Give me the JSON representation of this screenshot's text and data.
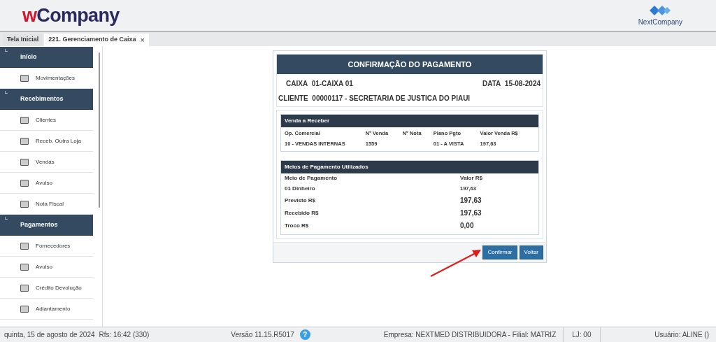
{
  "header": {
    "logo": {
      "prefix": "w",
      "name": "Company"
    },
    "brand": "NextCompany"
  },
  "tabs": [
    {
      "label": "Tela Inicial",
      "selected": false
    },
    {
      "label": "221. Gerenciamento de Caixa",
      "selected": true,
      "close": "×"
    }
  ],
  "sidebar": {
    "sections": [
      {
        "title": "Início",
        "items": [
          "Movimentações"
        ]
      },
      {
        "title": "Recebimentos",
        "items": [
          "Clientes",
          "Receb. Outra Loja",
          "Vendas",
          "Avulso",
          "Nota Fiscal"
        ]
      },
      {
        "title": "Pagamentos",
        "items": [
          "Fornecedores",
          "Avulso",
          "Crédito Devolução",
          "Adiantamento"
        ]
      }
    ]
  },
  "dialog": {
    "title": "CONFIRMAÇÃO DO PAGAMENTO",
    "caixa": {
      "label": "CAIXA",
      "value": "01-CAIXA 01"
    },
    "data": {
      "label": "DATA",
      "value": "15-08-2024"
    },
    "cliente": {
      "label": "CLIENTE",
      "value": "00000117 - SECRETARIA DE JUSTICA DO PIAUI"
    },
    "sale": {
      "title": "Venda a Receber",
      "columns": [
        "Op. Comercial",
        "Nº Venda",
        "Nº Nota",
        "Plano Pgto",
        "Valor Venda R$"
      ],
      "rows": [
        [
          "10 - VENDAS INTERNAS",
          "1559",
          "",
          "01 - A VISTA",
          "197,63"
        ]
      ]
    },
    "payments": {
      "title": "Meios de Pagamento Utilizados",
      "columns": [
        "Meio de Pagamento",
        "Valor R$"
      ],
      "rows": [
        {
          "kind": "detail",
          "label": "01 Dinheiro",
          "value": "197,63"
        },
        {
          "kind": "total",
          "label": "Previsto R$",
          "value": "197,63"
        },
        {
          "kind": "total",
          "label": "Recebido R$",
          "value": "197,63"
        },
        {
          "kind": "total",
          "label": "Troco R$",
          "value": "0,00"
        }
      ]
    },
    "buttons": [
      "Confirmar",
      "Voltar"
    ]
  },
  "status_bar": {
    "date": "quinta, 15 de agosto de 2024",
    "rfs": "Rfs: 16:42 (330)",
    "version": "Versão 11.15.R5017",
    "help": "?",
    "company": "Empresa: NEXTMED DISTRIBUIDORA - Filial: MATRIZ",
    "store": "LJ: 00",
    "user": "Usuário: ALINE ()"
  }
}
